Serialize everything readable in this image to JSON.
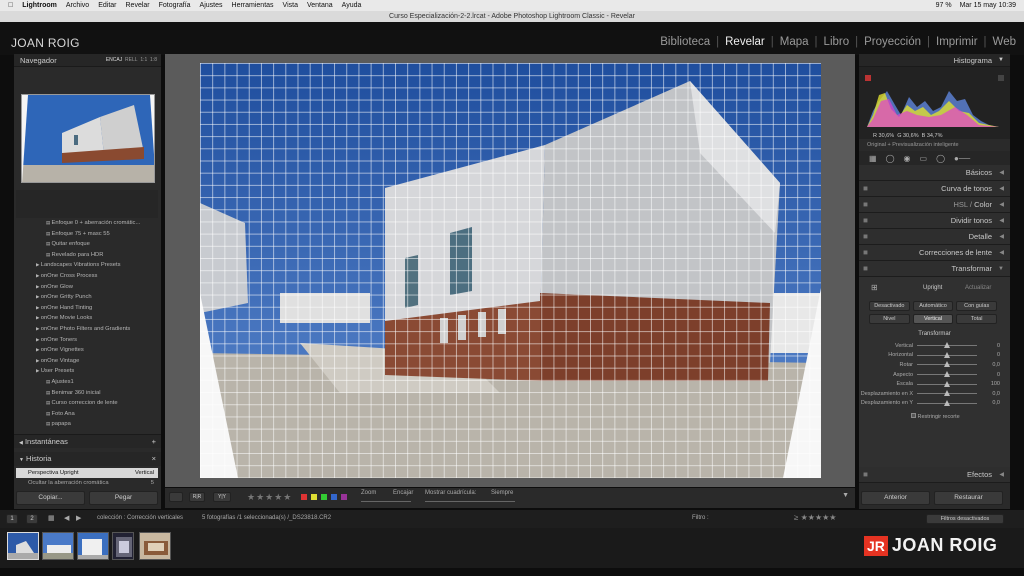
{
  "menubar": {
    "apple": "",
    "app": "Lightroom",
    "items": [
      "Archivo",
      "Editar",
      "Revelar",
      "Fotografía",
      "Ajustes",
      "Herramientas",
      "Vista",
      "Ventana",
      "Ayuda"
    ],
    "battery": "97 %",
    "datetime": "Mar 15 may  10:39"
  },
  "window": {
    "title": "Curso Especialización-2-2.lrcat - Adobe Photoshop Lightroom Classic - Revelar"
  },
  "identity": {
    "name": "JOAN ROIG"
  },
  "modules": [
    "Biblioteca",
    "Revelar",
    "Mapa",
    "Libro",
    "Proyección",
    "Imprimir",
    "Web"
  ],
  "navigator": {
    "title": "Navegador",
    "zoom": [
      "ENCAJ",
      "RELL",
      "1:1",
      "1:8"
    ]
  },
  "presets": [
    {
      "t": "Enfoque 0 + aberración cromátic...",
      "l": 1
    },
    {
      "t": "Enfoque 75 + masc 55",
      "l": 1
    },
    {
      "t": "Quitar enfoque",
      "l": 1
    },
    {
      "t": "Revelado para HDR",
      "l": 1
    },
    {
      "t": "Landscapes Vibrations Presets",
      "l": 0
    },
    {
      "t": "onOne Cross Process",
      "l": 0
    },
    {
      "t": "onOne Glow",
      "l": 0
    },
    {
      "t": "onOne Gritty Punch",
      "l": 0
    },
    {
      "t": "onOne Hand Tinting",
      "l": 0
    },
    {
      "t": "onOne Movie Looks",
      "l": 0
    },
    {
      "t": "onOne Photo Filters and Gradients",
      "l": 0
    },
    {
      "t": "onOne Toners",
      "l": 0
    },
    {
      "t": "onOne Vignettes",
      "l": 0
    },
    {
      "t": "onOne Vintage",
      "l": 0
    },
    {
      "t": "User Presets",
      "l": 0
    },
    {
      "t": "Ajustes1",
      "l": 1
    },
    {
      "t": "Benimar 360 inicial",
      "l": 1
    },
    {
      "t": "Curso correccion de lente",
      "l": 1
    },
    {
      "t": "Foto Ana",
      "l": 1
    },
    {
      "t": "papapa",
      "l": 1
    }
  ],
  "snapshots": {
    "title": "Instantáneas",
    "add": "+"
  },
  "history": {
    "title": "Historia",
    "close": "×",
    "rows": [
      {
        "name": "Perspectiva Upright",
        "value": "Vertical"
      },
      {
        "name": "Ocultar la aberración cromática",
        "value": "5"
      }
    ]
  },
  "left_buttons": {
    "copy": "Copiar...",
    "paste": "Pegar"
  },
  "toolbar": {
    "zoom_label": "Zoom",
    "zoom_value": "Encajar",
    "grid_label": "Mostrar cuadrícula:",
    "grid_value": "Siempre"
  },
  "histogram": {
    "title": "Histograma",
    "r_label": "R",
    "r": "30,6",
    "g_label": "G",
    "g": "30,6",
    "b_label": "B",
    "b": "34,7",
    "pct": "%",
    "preview": "Original + Previsualización inteligente"
  },
  "sections": {
    "basic": "Básicos",
    "tone_curve": "Curva de tonos",
    "hsl": "HSL",
    "hsl_sep": "/",
    "color": "Color",
    "split": "Dividir tonos",
    "detail": "Detalle",
    "lens": "Correcciones de lente",
    "transform": "Transformar",
    "effects": "Efectos"
  },
  "transform": {
    "upright": "Upright",
    "update": "Actualizar",
    "buttons": [
      "Desactivado",
      "Automático",
      "Con guías",
      "Nivel",
      "Vertical",
      "Total"
    ],
    "sub": "Transformar",
    "sliders": [
      {
        "name": "Vertical",
        "value": "0",
        "pos": 0.5
      },
      {
        "name": "Horizontal",
        "value": "0",
        "pos": 0.5
      },
      {
        "name": "Rotar",
        "value": "0,0",
        "pos": 0.5
      },
      {
        "name": "Aspecto",
        "value": "0",
        "pos": 0.5
      },
      {
        "name": "Escala",
        "value": "100",
        "pos": 0.5
      },
      {
        "name": "Desplazamiento en X",
        "value": "0,0",
        "pos": 0.5
      },
      {
        "name": "Desplazamiento en Y",
        "value": "0,0",
        "pos": 0.5
      }
    ],
    "constrain": "Restringir recorte"
  },
  "right_buttons": {
    "previous": "Anterior",
    "reset": "Restaurar"
  },
  "filmstrip": {
    "pages": [
      "1",
      "2"
    ],
    "source": "colección : Corrección verticales",
    "count": "5 fotografías /1 seleccionada(s) /_DS23818.CR2",
    "filter_label": "Filtro :",
    "filter_state": "Filtros desactivados"
  },
  "logo": {
    "jr": "JR",
    "name": "JOAN ROIG"
  },
  "colors": {
    "accent_red": "#e53322",
    "sky": "#2d5aa8"
  }
}
